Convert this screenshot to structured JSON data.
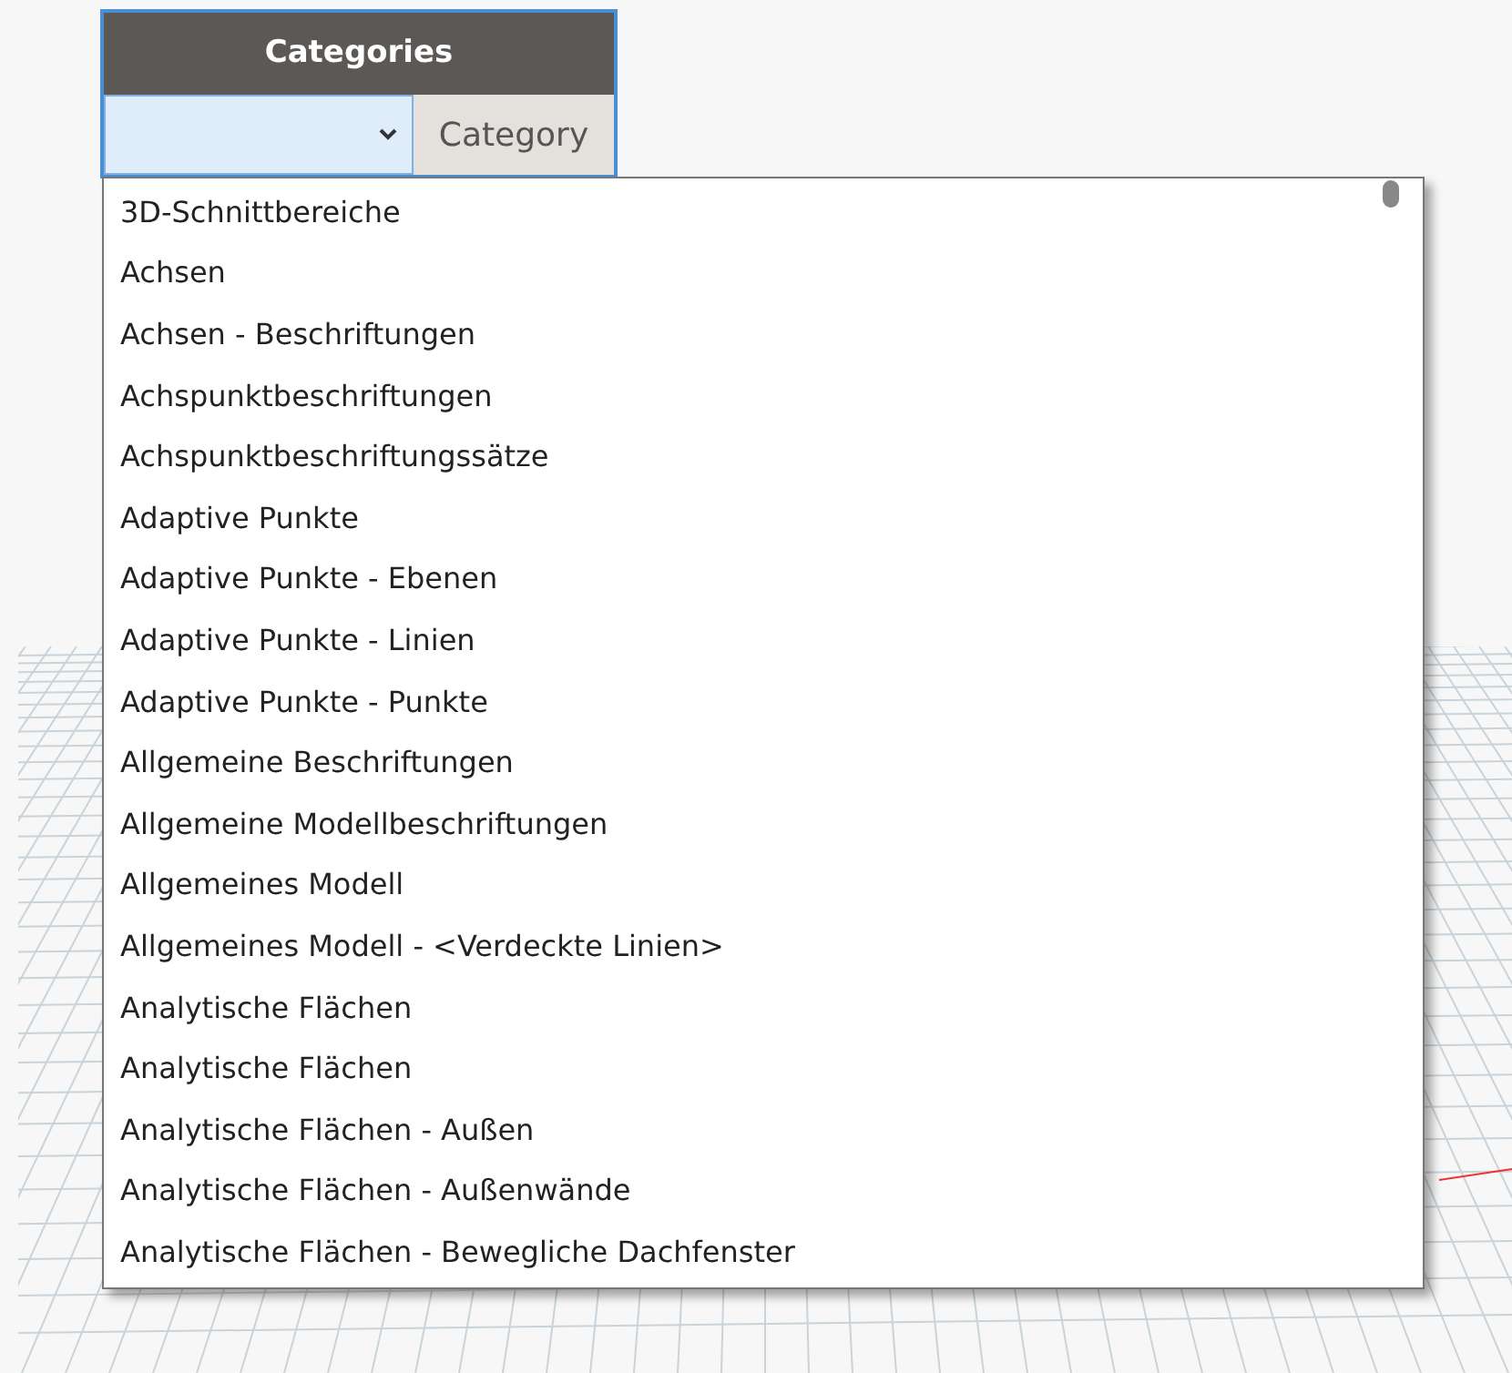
{
  "node": {
    "title": "Categories",
    "dropdown": {
      "expanded": true
    },
    "output_port": "Category"
  },
  "dropdown_list": {
    "items": [
      {
        "label": "3D-Schnittbereiche"
      },
      {
        "label": "Achsen"
      },
      {
        "label": "Achsen - Beschriftungen"
      },
      {
        "label": "Achspunktbeschriftungen"
      },
      {
        "label": "Achspunktbeschriftungssätze"
      },
      {
        "label": "Adaptive Punkte"
      },
      {
        "label": "Adaptive Punkte - Ebenen"
      },
      {
        "label": "Adaptive Punkte - Linien"
      },
      {
        "label": "Adaptive Punkte - Punkte"
      },
      {
        "label": "Allgemeine Beschriftungen"
      },
      {
        "label": "Allgemeine Modellbeschriftungen"
      },
      {
        "label": "Allgemeines Modell"
      },
      {
        "label": "Allgemeines Modell - <Verdeckte Linien>"
      },
      {
        "label": "Analytische Flächen"
      },
      {
        "label": "Analytische Flächen"
      },
      {
        "label": "Analytische Flächen - Außen"
      },
      {
        "label": "Analytische Flächen - Außenwände"
      },
      {
        "label": "Analytische Flächen - Bewegliche Dachfenster"
      }
    ]
  }
}
